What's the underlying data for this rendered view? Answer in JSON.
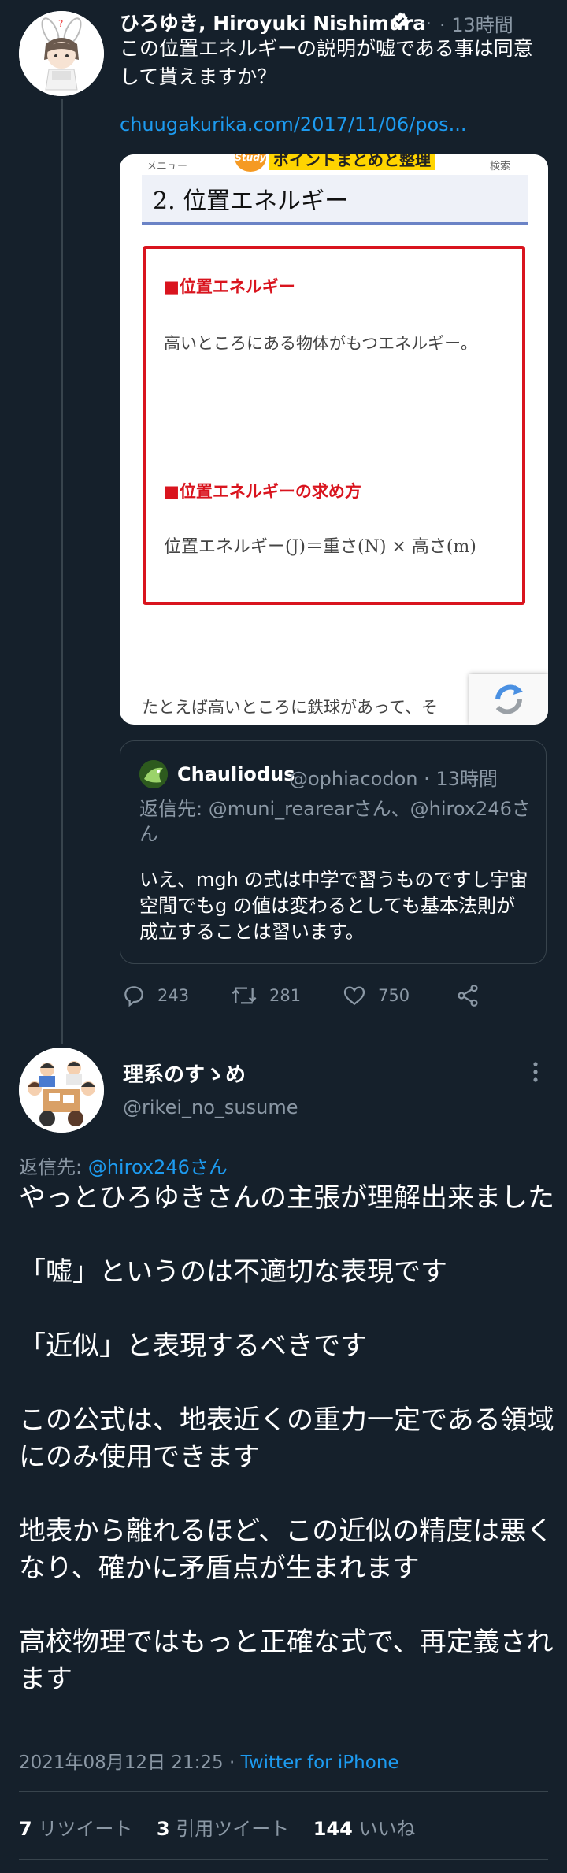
{
  "tweet1": {
    "display_name": "ひろゆき, Hiroyuki Nishimura",
    "dots": "…",
    "time": "· 13時間",
    "body": "この位置エネルギーの説明が嘘である事は同意して貰えますか？",
    "link": "chuugakurika.com/2017/11/06/pos...",
    "card": {
      "menu": "メニュー",
      "search": "検索",
      "study_badge": "Study",
      "banner": "ポイントまとめと整理",
      "heading": "2.  位置エネルギー",
      "section1": "■位置エネルギー",
      "definition": "高いところにある物体がもつエネルギー。",
      "section2": "■位置エネルギーの求め方",
      "formula": "位置エネルギー(J)＝重さ(N) × 高さ(m)",
      "bottom_text": "たとえば高いところに鉄球があって、そ"
    },
    "quote": {
      "name": "Chauliodus",
      "handle": "@ophiacodon · 13時間",
      "reply_to": "返信先: @muni_rearearさん、@hirox246さん",
      "body": "いえ、mgh の式は中学で習うものですし宇宙空間でもg の値は変わるとしても基本法則が成立することは習います。"
    },
    "actions": {
      "replies": "243",
      "retweets": "281",
      "likes": "750"
    }
  },
  "tweet2": {
    "display_name": "理系のすゝめ",
    "handle": "@rikei_no_susume",
    "reply_prefix": "返信先: ",
    "reply_handle": "@hirox246さん",
    "body": "やっとひろゆきさんの主張が理解出来ました\n\n「嘘」というのは不適切な表現です\n\n「近似」と表現するべきです\n\nこの公式は、地表近くの重力一定である領域にのみ使用できます\n\n地表から離れるほど、この近似の精度は悪くなり、確かに矛盾点が生まれます\n\n高校物理ではもっと正確な式で、再定義されます",
    "date": "2021年08月12日 21:25 · ",
    "client": "Twitter for iPhone",
    "stats": {
      "retweets_count": "7",
      "retweets_label": "リツイート",
      "quotes_count": "3",
      "quotes_label": "引用ツイート",
      "likes_count": "144",
      "likes_label": "いいね"
    }
  },
  "colors": {
    "background": "#15202b",
    "text": "#ffffff",
    "muted": "#8b98a5",
    "link": "#1d9bf0",
    "border": "#38444d",
    "verified": "#ffffff"
  }
}
